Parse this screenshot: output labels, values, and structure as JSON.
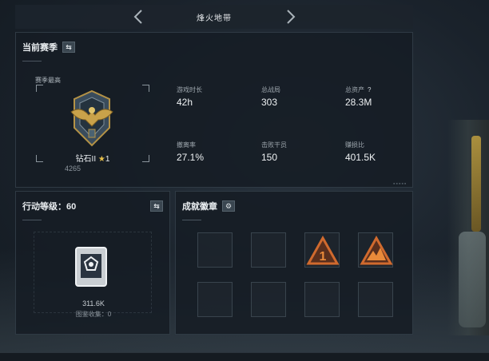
{
  "header": {
    "title": "烽火地带"
  },
  "season": {
    "title": "当前赛季",
    "subtitle": "赛季最高",
    "rank_name": "钻石II",
    "rank_stars": "1",
    "rank_score": "4265",
    "stats": [
      {
        "label": "游戏时长",
        "value": "42h"
      },
      {
        "label": "总战局",
        "value": "303"
      },
      {
        "label": "总资产",
        "value": "28.3M",
        "help": "?"
      },
      {
        "label": "撤离率",
        "value": "27.1%"
      },
      {
        "label": "击败干员",
        "value": "150"
      },
      {
        "label": "赚损比",
        "value": "401.5K"
      }
    ]
  },
  "level": {
    "title": "行动等级：60",
    "score": "311.6K",
    "sub": "图鉴收集：0"
  },
  "badges": {
    "title": "成就徽章",
    "slots": [
      "empty",
      "empty",
      "badge-1",
      "badge-mountain",
      "empty",
      "empty",
      "empty",
      "empty"
    ]
  },
  "colors": {
    "badge_orange": "#d06a2e",
    "badge_bg": "#5a2f1d",
    "star": "#e8c04a"
  }
}
